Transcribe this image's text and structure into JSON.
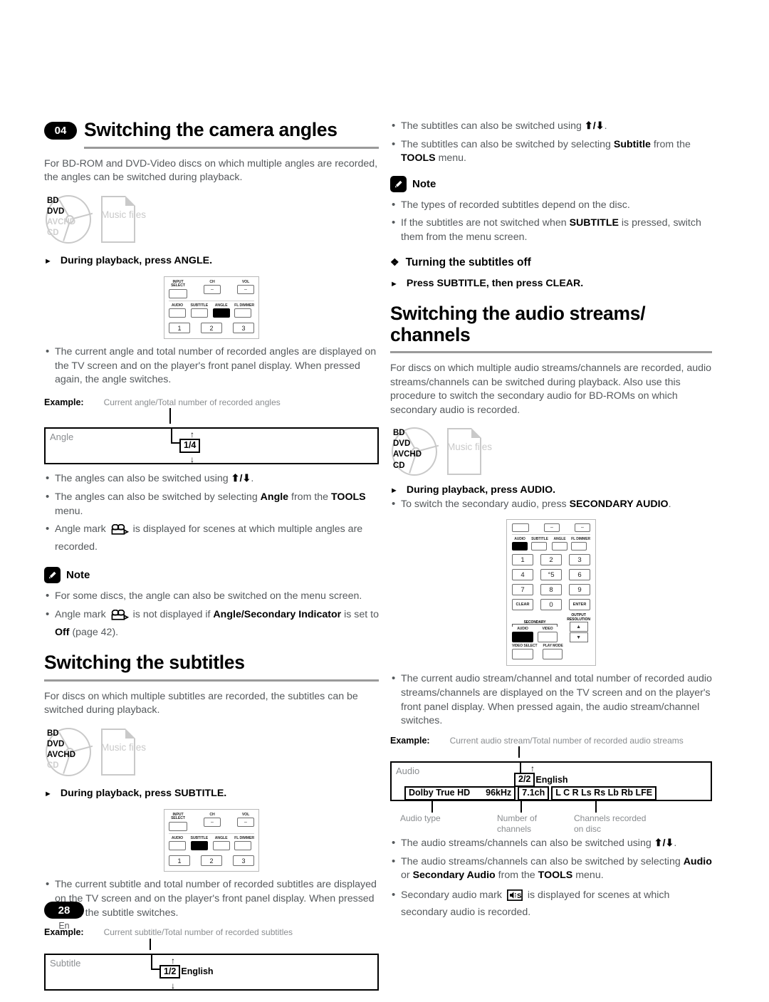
{
  "chapter": {
    "number": "04"
  },
  "footer": {
    "page": "28",
    "language": "En"
  },
  "sections": {
    "camera_angles": {
      "title": "Switching the camera angles",
      "intro": "For BD-ROM and DVD-Video discs on which multiple angles are recorded, the angles can be switched during playback.",
      "media": {
        "disc_labels": [
          "BD",
          "DVD",
          "AVCHD",
          "CD"
        ],
        "disc_active": [
          "BD",
          "DVD"
        ],
        "file_label": "Music files"
      },
      "step": "During playback, press ANGLE.",
      "remote": {
        "top_keys": [
          "INPUT SELECT",
          "CH",
          "VOL"
        ],
        "mid_keys": [
          "AUDIO",
          "SUBTITLE",
          "ANGLE",
          "FL DIMMER"
        ],
        "highlight": "ANGLE",
        "num_keys": [
          "1",
          "2",
          "3"
        ]
      },
      "bullets": [
        "The current angle and total number of recorded angles are displayed on the TV screen and on the player's front panel display. When pressed again, the angle switches."
      ],
      "example": {
        "label": "Example:",
        "caption": "Current angle/Total number of recorded angles",
        "screen_label": "Angle",
        "chip": "1/4"
      },
      "bullets2": [
        {
          "text": "The angles can also be switched using ",
          "arrows": "⬆/⬇",
          "tail": "."
        },
        {
          "text": "The angles can also be switched by selecting ",
          "bold": "Angle",
          "tail": " from the ",
          "bold2": "TOOLS",
          "tail2": " menu."
        },
        {
          "text": "Angle mark ",
          "icon": "angle-mark",
          "tail": " is displayed for scenes at which multiple angles are recorded."
        }
      ],
      "note": {
        "title": "Note",
        "items": [
          {
            "text": "For some discs, the angle can also be switched on the menu screen."
          },
          {
            "text": "Angle mark ",
            "icon": "angle-mark",
            "tail": " is not displayed if ",
            "bold": "Angle/Secondary Indicator",
            "tail2": " is set to ",
            "bold2": "Off",
            "tail3": " (page 42)."
          }
        ]
      }
    },
    "subtitles": {
      "title": "Switching the subtitles",
      "intro": "For discs on which multiple subtitles are recorded, the subtitles can be switched during playback.",
      "media": {
        "disc_labels": [
          "BD",
          "DVD",
          "AVCHD",
          "CD"
        ],
        "disc_active": [
          "BD",
          "DVD",
          "AVCHD"
        ],
        "file_label": "Music files"
      },
      "step": "During playback, press SUBTITLE.",
      "remote": {
        "top_keys": [
          "INPUT SELECT",
          "CH",
          "VOL"
        ],
        "mid_keys": [
          "AUDIO",
          "SUBTITLE",
          "ANGLE",
          "FL DIMMER"
        ],
        "highlight": "SUBTITLE",
        "num_keys": [
          "1",
          "2",
          "3"
        ]
      },
      "bullets": [
        "The current subtitle and total number of recorded subtitles are displayed on the TV screen and on the player's front panel display. When pressed again, the subtitle switches."
      ],
      "example": {
        "label": "Example:",
        "caption": "Current subtitle/Total number of recorded subtitles",
        "screen_label": "Subtitle",
        "chip": "1/2",
        "chip_suffix": "English"
      },
      "bullets2": [
        {
          "text": "The subtitles can also be switched using ",
          "arrows": "⬆/⬇",
          "tail": "."
        },
        {
          "text": "The subtitles can also be switched by selecting ",
          "bold": "Subtitle",
          "tail": " from the ",
          "bold2": "TOOLS",
          "tail2": " menu."
        }
      ],
      "note": {
        "title": "Note",
        "items": [
          {
            "text": "The types of recorded subtitles depend on the disc."
          },
          {
            "text": "If the subtitles are not switched when ",
            "bold": "SUBTITLE",
            "tail": " is pressed, switch them from the menu screen."
          }
        ]
      },
      "turning_off": {
        "heading": "Turning the subtitles off",
        "step": "Press SUBTITLE, then press CLEAR."
      }
    },
    "audio_streams": {
      "title": "Switching the audio streams/ channels",
      "intro": "For discs on which multiple audio streams/channels are recorded, audio streams/channels can be switched during playback. Also use this procedure to switch the secondary audio for BD-ROMs on which secondary audio is recorded.",
      "media": {
        "disc_labels": [
          "BD",
          "DVD",
          "AVCHD",
          "CD"
        ],
        "disc_active": [
          "BD",
          "DVD",
          "AVCHD",
          "CD"
        ],
        "file_label": "Music files"
      },
      "step": "During playback, press AUDIO.",
      "step_sub": {
        "text": "To switch the secondary audio, press ",
        "bold": "SECONDARY AUDIO",
        "tail": "."
      },
      "remote": {
        "top_keys": [
          "",
          "CH",
          "VOL"
        ],
        "mid_keys": [
          "AUDIO",
          "SUBTITLE",
          "ANGLE",
          "FL DIMMER"
        ],
        "highlight": "AUDIO",
        "num_rows": [
          [
            "1",
            "2",
            "3"
          ],
          [
            "4",
            "°5",
            "6"
          ],
          [
            "7",
            "8",
            "9"
          ]
        ],
        "bottom_row": [
          "CLEAR",
          "0",
          "ENTER"
        ],
        "secondary_label": "SECONDARY",
        "secondary_keys": [
          "AUDIO",
          "VIDEO"
        ],
        "output_resolution": "OUTPUT RESOLUTION",
        "last_row": [
          "VIDEO SELECT",
          "PLAY MODE"
        ],
        "updown": [
          "▲",
          "▼"
        ]
      },
      "bullets": [
        "The current audio stream/channel and total number of recorded audio streams/channels are displayed on the TV screen and on the player's front panel display. When pressed again, the audio stream/channel switches."
      ],
      "example": {
        "label": "Example:",
        "caption": "Current audio stream/Total number of recorded audio streams",
        "screen_label": "Audio",
        "chip": "2/2",
        "chip_suffix": "English",
        "row": {
          "type_chip": "Dolby True HD",
          "rate": "96kHz",
          "channels": "7.1ch",
          "layout": "L C R Ls Rs Lb Rb LFE"
        },
        "callouts": [
          "Audio type",
          "Number of channels",
          "Channels recorded on disc"
        ]
      },
      "bullets2": [
        {
          "text": "The audio streams/channels can also be switched using ",
          "arrows": "⬆/⬇",
          "tail": "."
        },
        {
          "text": "The audio streams/channels can also be switched by selecting ",
          "bold": "Audio",
          "tail": " or ",
          "bold2": "Secondary Audio",
          "tail2": " from the ",
          "bold3": "TOOLS",
          "tail3": " menu."
        },
        {
          "text": "Secondary audio mark ",
          "icon": "secondary-audio-mark",
          "tail": " is displayed for scenes at which secondary audio is recorded."
        }
      ]
    }
  }
}
